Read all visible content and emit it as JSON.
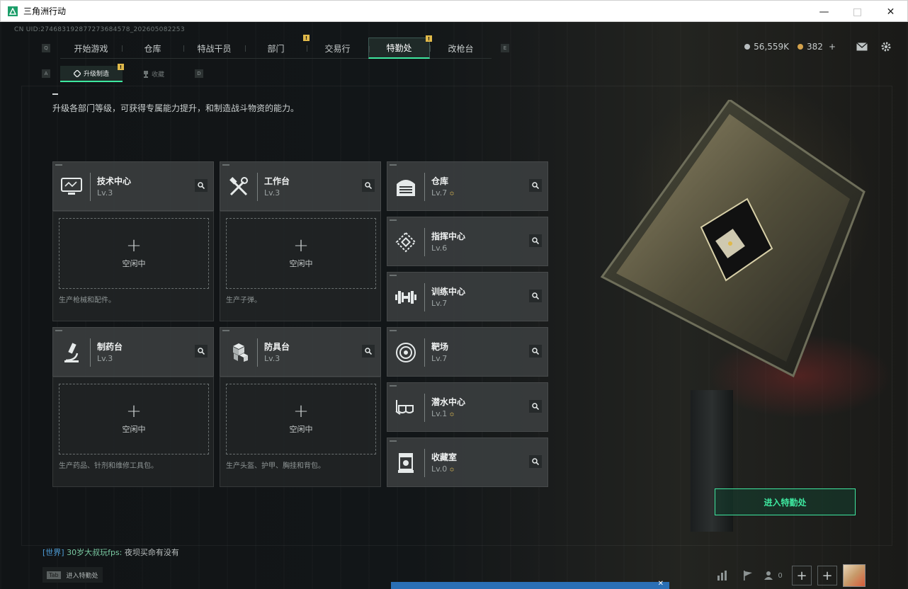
{
  "window": {
    "title": "三角洲行动",
    "controls": [
      "—",
      "□",
      "✕"
    ]
  },
  "uid": "CN UID:274683192877273684578_202605082253",
  "nav": {
    "key_left": "Q",
    "key_right": "E",
    "tabs": [
      {
        "label": "开始游戏",
        "active": false,
        "badge": ""
      },
      {
        "label": "仓库",
        "active": false,
        "badge": ""
      },
      {
        "label": "特战干员",
        "active": false,
        "badge": ""
      },
      {
        "label": "部门",
        "active": false,
        "badge": "!"
      },
      {
        "label": "交易行",
        "active": false,
        "badge": ""
      },
      {
        "label": "特勤处",
        "active": true,
        "badge": "!"
      },
      {
        "label": "改枪台",
        "active": false,
        "badge": ""
      }
    ]
  },
  "currency": {
    "silver": "56,559K",
    "gold": "382",
    "gold_add": "+"
  },
  "subnav": {
    "key_left": "A",
    "key_right": "D",
    "tabs": [
      {
        "label": "升级制造",
        "active": true,
        "badge": "!"
      },
      {
        "label": "收藏",
        "active": false,
        "badge": ""
      }
    ]
  },
  "description": "升级各部门等级，可获得专属能力提升，和制造战斗物资的能力。",
  "production": [
    {
      "name": "技术中心",
      "level": "Lv.3",
      "icon": "computer-icon",
      "slot": "空闲中",
      "caption": "生产枪械和配件。"
    },
    {
      "name": "工作台",
      "level": "Lv.3",
      "icon": "tools-icon",
      "slot": "空闲中",
      "caption": "生产子弹。"
    },
    {
      "name": "制药台",
      "level": "Lv.3",
      "icon": "microscope-icon",
      "slot": "空闲中",
      "caption": "生产药品、针剂和维修工具包。"
    },
    {
      "name": "防具台",
      "level": "Lv.3",
      "icon": "armor-blocks-icon",
      "slot": "空闲中",
      "caption": "生产头盔、护甲、胸挂和背包。"
    }
  ],
  "facilities": [
    {
      "name": "仓库",
      "level": "Lv.7",
      "icon": "warehouse-icon",
      "upgradable": true
    },
    {
      "name": "指挥中心",
      "level": "Lv.6",
      "icon": "chip-icon",
      "upgradable": false
    },
    {
      "name": "训练中心",
      "level": "Lv.7",
      "icon": "dumbbell-icon",
      "upgradable": false
    },
    {
      "name": "靶场",
      "level": "Lv.7",
      "icon": "target-icon",
      "upgradable": false
    },
    {
      "name": "潜水中心",
      "level": "Lv.1",
      "icon": "diving-mask-icon",
      "upgradable": true
    },
    {
      "name": "收藏室",
      "level": "Lv.0",
      "icon": "trophy-case-icon",
      "upgradable": true
    }
  ],
  "up_arrow": "≎",
  "enter_button": "进入特勤处",
  "chat": {
    "channel": "[世界]",
    "user": "30岁大叔玩fps:",
    "message": "夜坝买命有没有"
  },
  "tab_hint": {
    "key": "Tab",
    "label": "进入特勤处"
  },
  "bottom": {
    "friends_count": "0"
  },
  "colors": {
    "accent": "#3ee8a0",
    "badge": "#e0b94a",
    "card": "#3a3d3e"
  }
}
